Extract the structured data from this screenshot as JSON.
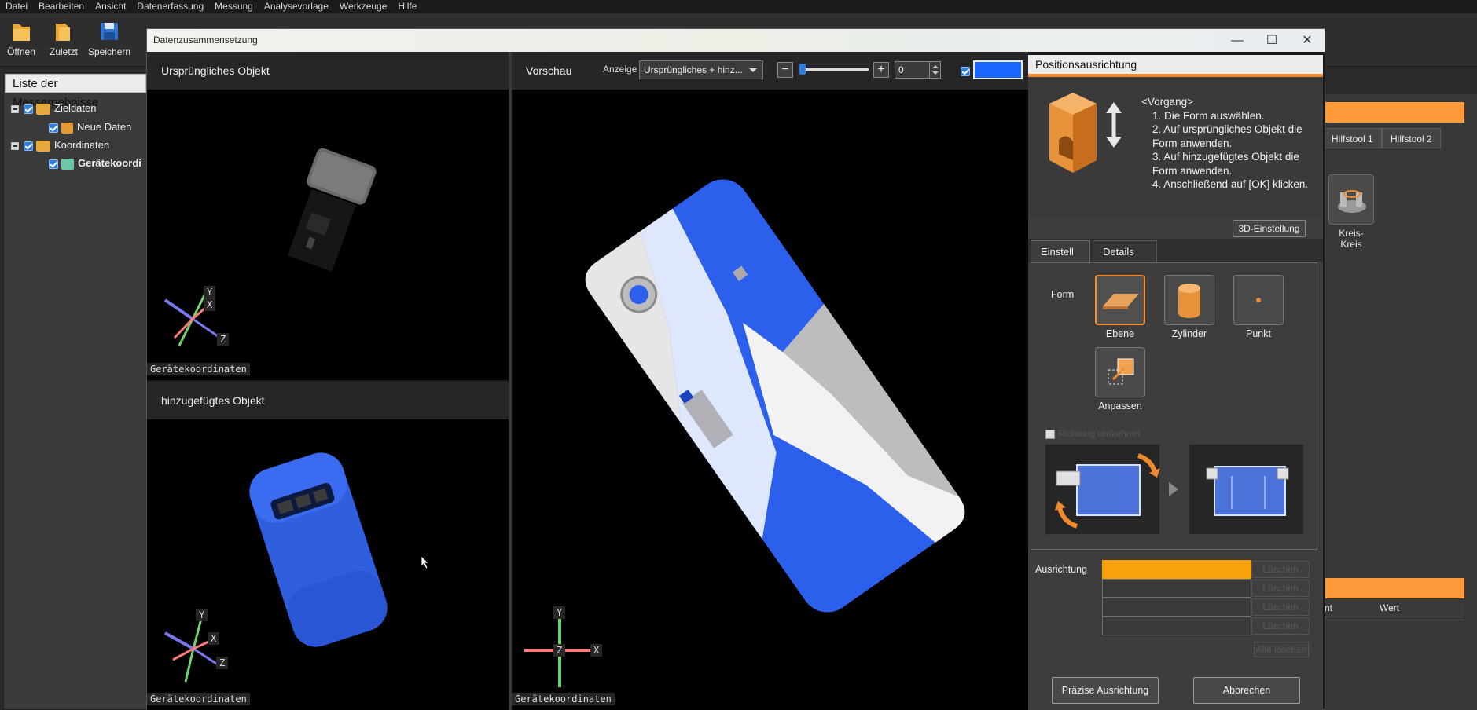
{
  "menu": [
    "Datei",
    "Bearbeiten",
    "Ansicht",
    "Datenerfassung",
    "Messung",
    "Analysevorlage",
    "Werkzeuge",
    "Hilfe"
  ],
  "ribbon": {
    "open": "Öffnen",
    "recent": "Zuletzt",
    "save": "Speichern"
  },
  "left_panel": {
    "title": "Liste der Messergebnisse",
    "items": [
      "Zieldaten",
      "Neue Daten",
      "Koordinaten",
      "Gerätekoordi"
    ]
  },
  "background_right": {
    "tabs": [
      "Hilfstool 1",
      "Hilfstool 2"
    ],
    "kreis_label_1": "Kreis-",
    "kreis_label_2": "Kreis",
    "table_cols": [
      "nt",
      "Wert"
    ]
  },
  "dialog": {
    "title": "Datenzusammensetzung",
    "original_object": "Ursprüngliches Objekt",
    "added_object": "hinzugefügtes Objekt",
    "preview": "Vorschau",
    "display_label": "Anzeige",
    "display_value": "Ursprüngliches + hinz...",
    "opacity_value": "0",
    "coord_label": "Gerätekoordinaten",
    "axis_x": "X",
    "axis_y": "Y",
    "axis_z": "Z",
    "minimize": "—",
    "maximize": "☐",
    "close": "✕"
  },
  "position_panel": {
    "title": "Positionsausrichtung",
    "procedure_title": "<Vorgang>",
    "steps": [
      "1.  Die Form auswählen.",
      "2.  Auf ursprüngliches Objekt die Form anwenden.",
      "3.  Auf hinzugefügtes Objekt die Form anwenden.",
      "4.  Anschließend auf [OK] klicken."
    ],
    "btn_3d": "3D-Einstellung",
    "tabs": [
      "Einstell",
      "Details"
    ],
    "form_label": "Form",
    "shapes": [
      "Ebene",
      "Zylinder",
      "Punkt",
      "Anpassen"
    ],
    "reverse_direction": "Richtung umkehren",
    "alignment_label": "Ausrichtung",
    "delete": "Löschen",
    "delete_all": "Alle löschen",
    "precise": "Präzise Ausrichtung",
    "cancel": "Abbrechen"
  },
  "colors": {
    "accent_orange": "#f08a2e",
    "alignment_active": "#f7a20a",
    "object_blue": "#1a64ff"
  }
}
